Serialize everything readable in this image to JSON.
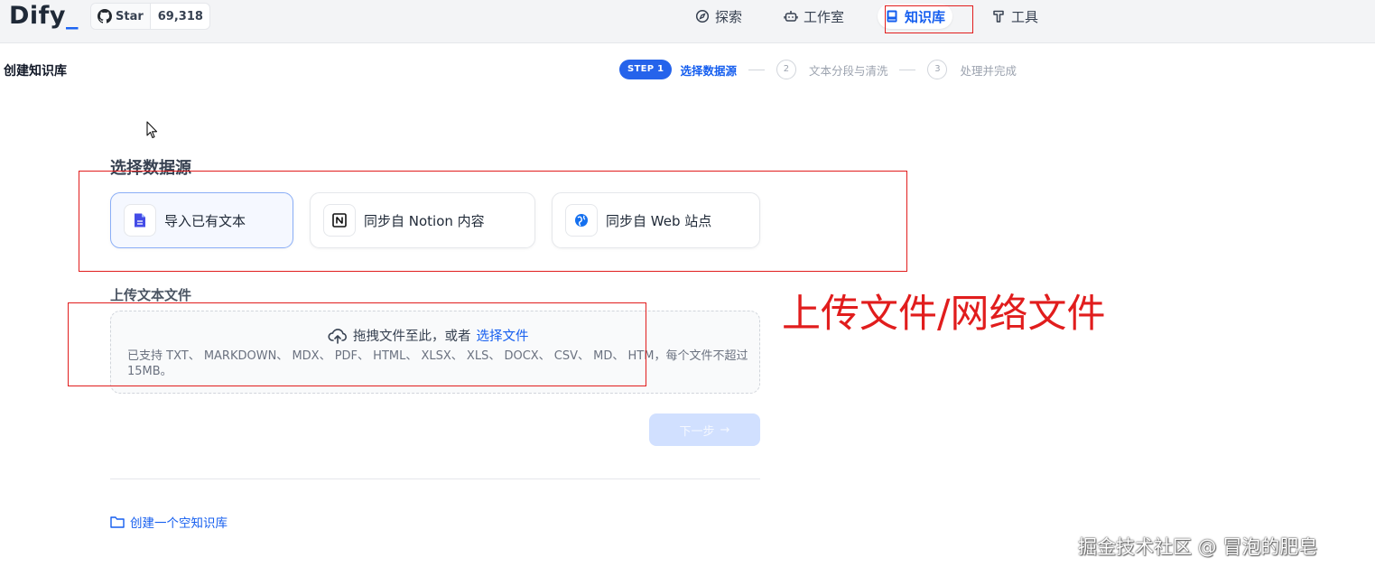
{
  "topbar": {
    "logo_text": "Dify",
    "logo_underscore": "_",
    "github_star_label": "Star",
    "github_star_count": "69,318",
    "nav": [
      {
        "label": "探索",
        "icon": "compass-icon",
        "active": false
      },
      {
        "label": "工作室",
        "icon": "robot-icon",
        "active": false
      },
      {
        "label": "知识库",
        "icon": "book-icon",
        "active": true
      },
      {
        "label": "工具",
        "icon": "hammer-icon",
        "active": false
      }
    ]
  },
  "header": {
    "title": "创建知识库",
    "steps": [
      {
        "badge": "STEP 1",
        "label": "选择数据源",
        "active": true
      },
      {
        "number": "2",
        "label": "文本分段与清洗",
        "active": false
      },
      {
        "number": "3",
        "label": "处理并完成",
        "active": false
      }
    ]
  },
  "data_source": {
    "title": "选择数据源",
    "options": [
      {
        "label": "导入已有文本",
        "icon": "file-text-icon",
        "selected": true
      },
      {
        "label": "同步自 Notion 内容",
        "icon": "notion-icon",
        "selected": false
      },
      {
        "label": "同步自 Web 站点",
        "icon": "web-icon",
        "selected": false
      }
    ]
  },
  "upload": {
    "title": "上传文本文件",
    "drag_text": "拖拽文件至此，或者",
    "select_link": "选择文件",
    "supported_formats": "已支持 TXT、 MARKDOWN、 MDX、 PDF、 HTML、 XLSX、 XLS、 DOCX、 CSV、 MD、 HTM，每个文件不超过 15MB。"
  },
  "next_button": {
    "label": "下一步",
    "arrow": "→"
  },
  "create_empty_label": "创建一个空知识库",
  "annotation": {
    "text": "上传文件/网络文件",
    "color": "#e11d1d"
  },
  "watermark": "掘金技术社区 @ 冒泡的肥皂",
  "colors": {
    "accent": "#155eef",
    "annotation_red": "#e11d1d"
  }
}
